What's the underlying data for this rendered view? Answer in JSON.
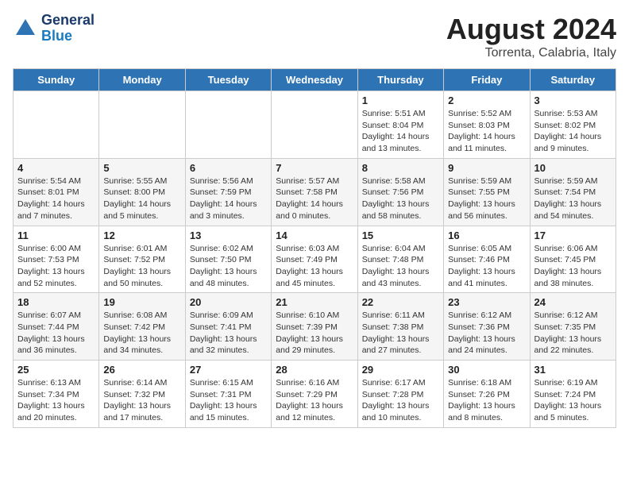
{
  "header": {
    "logo_line1": "General",
    "logo_line2": "Blue",
    "month_title": "August 2024",
    "location": "Torrenta, Calabria, Italy"
  },
  "days_of_week": [
    "Sunday",
    "Monday",
    "Tuesday",
    "Wednesday",
    "Thursday",
    "Friday",
    "Saturday"
  ],
  "weeks": [
    [
      {
        "day": "",
        "info": ""
      },
      {
        "day": "",
        "info": ""
      },
      {
        "day": "",
        "info": ""
      },
      {
        "day": "",
        "info": ""
      },
      {
        "day": "1",
        "info": "Sunrise: 5:51 AM\nSunset: 8:04 PM\nDaylight: 14 hours\nand 13 minutes."
      },
      {
        "day": "2",
        "info": "Sunrise: 5:52 AM\nSunset: 8:03 PM\nDaylight: 14 hours\nand 11 minutes."
      },
      {
        "day": "3",
        "info": "Sunrise: 5:53 AM\nSunset: 8:02 PM\nDaylight: 14 hours\nand 9 minutes."
      }
    ],
    [
      {
        "day": "4",
        "info": "Sunrise: 5:54 AM\nSunset: 8:01 PM\nDaylight: 14 hours\nand 7 minutes."
      },
      {
        "day": "5",
        "info": "Sunrise: 5:55 AM\nSunset: 8:00 PM\nDaylight: 14 hours\nand 5 minutes."
      },
      {
        "day": "6",
        "info": "Sunrise: 5:56 AM\nSunset: 7:59 PM\nDaylight: 14 hours\nand 3 minutes."
      },
      {
        "day": "7",
        "info": "Sunrise: 5:57 AM\nSunset: 7:58 PM\nDaylight: 14 hours\nand 0 minutes."
      },
      {
        "day": "8",
        "info": "Sunrise: 5:58 AM\nSunset: 7:56 PM\nDaylight: 13 hours\nand 58 minutes."
      },
      {
        "day": "9",
        "info": "Sunrise: 5:59 AM\nSunset: 7:55 PM\nDaylight: 13 hours\nand 56 minutes."
      },
      {
        "day": "10",
        "info": "Sunrise: 5:59 AM\nSunset: 7:54 PM\nDaylight: 13 hours\nand 54 minutes."
      }
    ],
    [
      {
        "day": "11",
        "info": "Sunrise: 6:00 AM\nSunset: 7:53 PM\nDaylight: 13 hours\nand 52 minutes."
      },
      {
        "day": "12",
        "info": "Sunrise: 6:01 AM\nSunset: 7:52 PM\nDaylight: 13 hours\nand 50 minutes."
      },
      {
        "day": "13",
        "info": "Sunrise: 6:02 AM\nSunset: 7:50 PM\nDaylight: 13 hours\nand 48 minutes."
      },
      {
        "day": "14",
        "info": "Sunrise: 6:03 AM\nSunset: 7:49 PM\nDaylight: 13 hours\nand 45 minutes."
      },
      {
        "day": "15",
        "info": "Sunrise: 6:04 AM\nSunset: 7:48 PM\nDaylight: 13 hours\nand 43 minutes."
      },
      {
        "day": "16",
        "info": "Sunrise: 6:05 AM\nSunset: 7:46 PM\nDaylight: 13 hours\nand 41 minutes."
      },
      {
        "day": "17",
        "info": "Sunrise: 6:06 AM\nSunset: 7:45 PM\nDaylight: 13 hours\nand 38 minutes."
      }
    ],
    [
      {
        "day": "18",
        "info": "Sunrise: 6:07 AM\nSunset: 7:44 PM\nDaylight: 13 hours\nand 36 minutes."
      },
      {
        "day": "19",
        "info": "Sunrise: 6:08 AM\nSunset: 7:42 PM\nDaylight: 13 hours\nand 34 minutes."
      },
      {
        "day": "20",
        "info": "Sunrise: 6:09 AM\nSunset: 7:41 PM\nDaylight: 13 hours\nand 32 minutes."
      },
      {
        "day": "21",
        "info": "Sunrise: 6:10 AM\nSunset: 7:39 PM\nDaylight: 13 hours\nand 29 minutes."
      },
      {
        "day": "22",
        "info": "Sunrise: 6:11 AM\nSunset: 7:38 PM\nDaylight: 13 hours\nand 27 minutes."
      },
      {
        "day": "23",
        "info": "Sunrise: 6:12 AM\nSunset: 7:36 PM\nDaylight: 13 hours\nand 24 minutes."
      },
      {
        "day": "24",
        "info": "Sunrise: 6:12 AM\nSunset: 7:35 PM\nDaylight: 13 hours\nand 22 minutes."
      }
    ],
    [
      {
        "day": "25",
        "info": "Sunrise: 6:13 AM\nSunset: 7:34 PM\nDaylight: 13 hours\nand 20 minutes."
      },
      {
        "day": "26",
        "info": "Sunrise: 6:14 AM\nSunset: 7:32 PM\nDaylight: 13 hours\nand 17 minutes."
      },
      {
        "day": "27",
        "info": "Sunrise: 6:15 AM\nSunset: 7:31 PM\nDaylight: 13 hours\nand 15 minutes."
      },
      {
        "day": "28",
        "info": "Sunrise: 6:16 AM\nSunset: 7:29 PM\nDaylight: 13 hours\nand 12 minutes."
      },
      {
        "day": "29",
        "info": "Sunrise: 6:17 AM\nSunset: 7:28 PM\nDaylight: 13 hours\nand 10 minutes."
      },
      {
        "day": "30",
        "info": "Sunrise: 6:18 AM\nSunset: 7:26 PM\nDaylight: 13 hours\nand 8 minutes."
      },
      {
        "day": "31",
        "info": "Sunrise: 6:19 AM\nSunset: 7:24 PM\nDaylight: 13 hours\nand 5 minutes."
      }
    ]
  ]
}
